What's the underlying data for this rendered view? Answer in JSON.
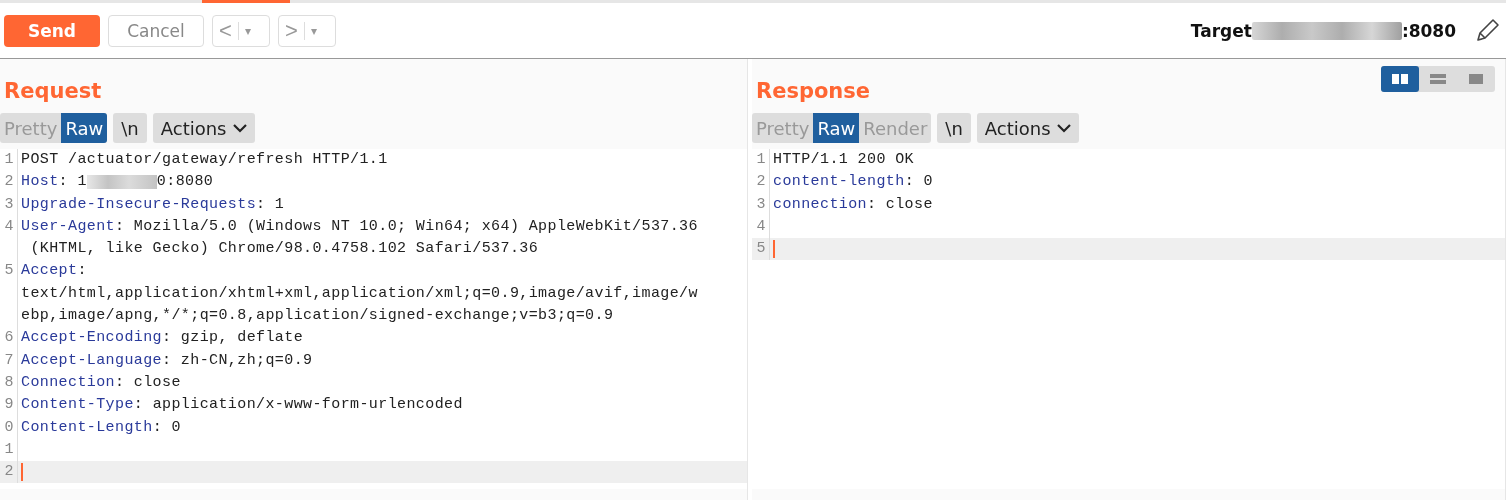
{
  "toolbar": {
    "send": "Send",
    "cancel": "Cancel",
    "back": "<",
    "forward": ">",
    "dropdown_glyph": "▾",
    "target_label": "Target",
    "target_port": ":8080"
  },
  "layout_modes": [
    {
      "kind": "split",
      "selected": true
    },
    {
      "kind": "stacked",
      "selected": false
    },
    {
      "kind": "single",
      "selected": false
    }
  ],
  "request": {
    "title": "Request",
    "view_tabs": [
      {
        "label": "Pretty",
        "selected": false
      },
      {
        "label": "Raw",
        "selected": true
      }
    ],
    "newline_toggle": "\\n",
    "actions": "Actions",
    "lines": [
      {
        "number": "1",
        "value": "POST /actuator/gateway/refresh HTTP/1.1",
        "current": false
      },
      {
        "number": "2",
        "key": "Host",
        "value": ": 1",
        "value_end": "0:8080",
        "redacted": true,
        "current": false
      },
      {
        "number": "3",
        "key": "Upgrade-Insecure-Requests",
        "value": ": 1",
        "current": false
      },
      {
        "number": "4",
        "key": "User-Agent",
        "value": ": Mozilla/5.0 (Windows NT 10.0; Win64; x64) AppleWebKit/537.36",
        "wrapped": [
          " (KHTML, like Gecko) Chrome/98.0.4758.102 Safari/537.36"
        ],
        "current": false
      },
      {
        "number": "5",
        "key": "Accept",
        "value": ":",
        "wrapped": [
          "text/html,application/xhtml+xml,application/xml;q=0.9,image/avif,image/w",
          "ebp,image/apng,*/*;q=0.8,application/signed-exchange;v=b3;q=0.9"
        ],
        "current": false
      },
      {
        "number": "6",
        "key": "Accept-Encoding",
        "value": ": gzip, deflate",
        "current": false
      },
      {
        "number": "7",
        "key": "Accept-Language",
        "value": ": zh-CN,zh;q=0.9",
        "current": false
      },
      {
        "number": "8",
        "key": "Connection",
        "value": ": close",
        "current": false
      },
      {
        "number": "9",
        "key": "Content-Type",
        "value": ": application/x-www-form-urlencoded",
        "current": false
      },
      {
        "number": "0",
        "key": "Content-Length",
        "value": ": 0",
        "current": false
      },
      {
        "number": "1",
        "current": false
      },
      {
        "number": "2",
        "current": true
      }
    ]
  },
  "response": {
    "title": "Response",
    "view_tabs": [
      {
        "label": "Pretty",
        "selected": false
      },
      {
        "label": "Raw",
        "selected": true
      },
      {
        "label": "Render",
        "selected": false
      }
    ],
    "newline_toggle": "\\n",
    "actions": "Actions",
    "lines": [
      {
        "number": "1",
        "value": "HTTP/1.1 200 OK",
        "current": false
      },
      {
        "number": "2",
        "key": "content-length",
        "value": ": 0",
        "current": false
      },
      {
        "number": "3",
        "key": "connection",
        "value": ": close",
        "current": false
      },
      {
        "number": "4",
        "current": false
      },
      {
        "number": "5",
        "current": true
      }
    ]
  }
}
